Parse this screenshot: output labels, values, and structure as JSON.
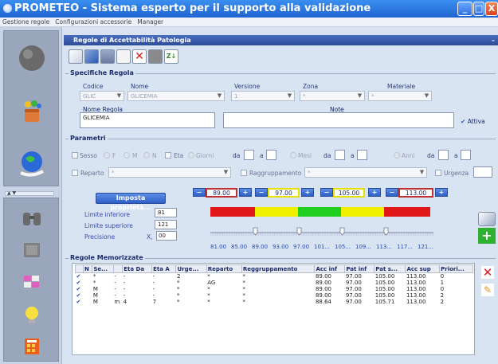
{
  "window": {
    "title": "PROMETEO - Sistema esperto per il supporto alla validazione",
    "min": "_",
    "max": "□",
    "close": "X"
  },
  "menu": [
    "Gestione regole",
    "Configurazioni accessorie",
    "Manager"
  ],
  "panel": {
    "title": "Regole di Accettabilità Patologia"
  },
  "toolbar": {
    "icons": [
      "eraser-icon",
      "check-edit-icon",
      "table-icon",
      "document-icon",
      "delete-icon",
      "book-icon",
      "sort-az-icon"
    ]
  },
  "spec": {
    "title": "Specifiche Regola",
    "codice_label": "Codice",
    "codice_value": "GLIC",
    "nome_label": "Nome",
    "nome_value": "GLICEMIA",
    "versione_label": "Versione",
    "versione_value": "1",
    "zona_label": "Zona",
    "zona_value": "*",
    "materiale_label": "Materiale",
    "materiale_value": "*",
    "nome_regola_label": "Nome Regola",
    "nome_regola_value": "GLICEMIA",
    "note_label": "Note",
    "note_value": "",
    "attiva_label": "Attiva"
  },
  "param": {
    "title": "Parametri",
    "sesso": "Sesso",
    "f": "F",
    "m": "M",
    "n": "N",
    "eta": "Eta",
    "giorni": "Giorni",
    "da1": "da",
    "a1": "a",
    "mesi": "Mesi",
    "da2": "da",
    "a2": "a",
    "anni": "Anni",
    "da3": "da",
    "a3": "a",
    "reparto": "Reparto",
    "reparto_value": "*",
    "raggruppamento": "Raggruppamento",
    "raggruppamento_value": "*",
    "urgenza": "Urgenza"
  },
  "proprieta": {
    "button": "Imposta proprietà...",
    "thresholds": [
      "89.00",
      "97.00",
      "105.00",
      "113.00"
    ],
    "limite_inferiore_label": "Limite inferiore",
    "limite_inferiore": "81",
    "limite_superiore_label": "Limite superiore",
    "limite_superiore": "121",
    "precisione_label": "Precisione",
    "precisione_prefix": "X,",
    "precisione": "00",
    "ticks": [
      "81.00",
      "85.00",
      "89.00",
      "93.00",
      "97.00",
      "101...",
      "105...",
      "109...",
      "113...",
      "117...",
      "121..."
    ]
  },
  "memorizzate": {
    "title": "Regole Memorizzate",
    "columns": [
      "N",
      "Se...",
      "",
      "Eta Da",
      "Eta A",
      "Urge...",
      "Reparto",
      "Reggruppamento",
      "Acc inf",
      "Pat inf",
      "Pat s...",
      "Acc sup",
      "Priori..."
    ],
    "rows": [
      [
        "*",
        "-",
        "-",
        "-",
        "2",
        "*",
        "*",
        "89.00",
        "97.00",
        "105.00",
        "113.00",
        "0"
      ],
      [
        "*",
        "-",
        "-",
        "-",
        "*",
        "AG",
        "*",
        "89.00",
        "97.00",
        "105.00",
        "113.00",
        "1"
      ],
      [
        "M",
        "-",
        "-",
        "-",
        "*",
        "*",
        "*",
        "89.00",
        "97.00",
        "105.00",
        "113.00",
        "0"
      ],
      [
        "M",
        "-",
        "-",
        "-",
        "*",
        "*",
        "*",
        "89.00",
        "97.00",
        "105.00",
        "113.00",
        "2"
      ],
      [
        "M",
        "m",
        "4",
        "7",
        "*",
        "*",
        "*",
        "88.64",
        "97.00",
        "105.71",
        "113.00",
        "2"
      ]
    ]
  },
  "colors": {
    "red": "#e01818",
    "yellow": "#f0f000",
    "green": "#20d020",
    "accent": "#2d5fc6"
  }
}
